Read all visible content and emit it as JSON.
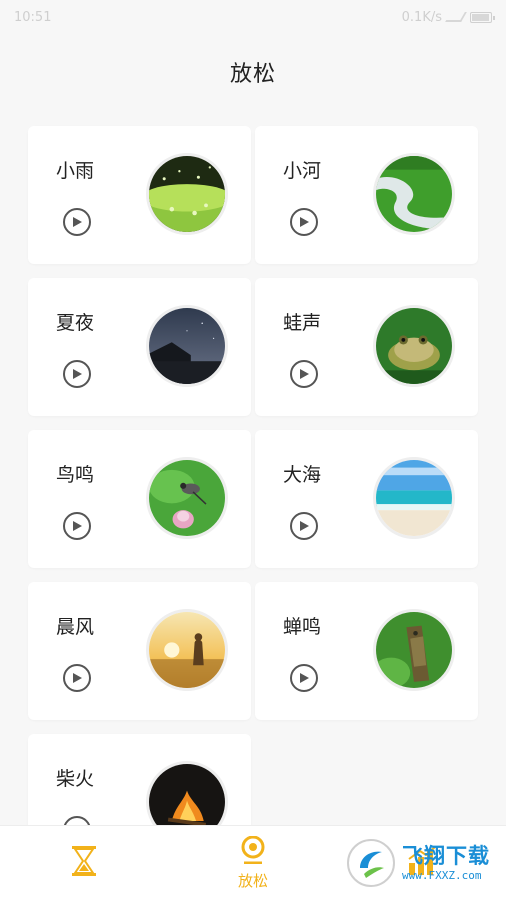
{
  "status_bar": {
    "time": "10:51",
    "right_text": "0.1K/s"
  },
  "header": {
    "title": "放松"
  },
  "sounds": [
    {
      "label": "小雨",
      "icon": "play-icon",
      "thumbnail": "rain-on-grass"
    },
    {
      "label": "小河",
      "icon": "play-icon",
      "thumbnail": "river"
    },
    {
      "label": "夏夜",
      "icon": "play-icon",
      "thumbnail": "night-sky"
    },
    {
      "label": "蛙声",
      "icon": "play-icon",
      "thumbnail": "frog"
    },
    {
      "label": "鸟鸣",
      "icon": "play-icon",
      "thumbnail": "bird-on-lotus"
    },
    {
      "label": "大海",
      "icon": "play-icon",
      "thumbnail": "sea"
    },
    {
      "label": "晨风",
      "icon": "play-icon",
      "thumbnail": "morning-sunrise"
    },
    {
      "label": "蝉鸣",
      "icon": "play-icon",
      "thumbnail": "cicada"
    },
    {
      "label": "柴火",
      "icon": "play-icon",
      "thumbnail": "campfire"
    }
  ],
  "tabbar": {
    "tabs": [
      {
        "label": "",
        "icon": "hourglass-icon"
      },
      {
        "label": "放松",
        "icon": "relax-icon",
        "active": true
      },
      {
        "label": "",
        "icon": "chart-icon"
      }
    ]
  },
  "watermark": {
    "title": "飞翔下载",
    "url": "www.FXXZ.com"
  },
  "colors": {
    "accent": "#f2b21a",
    "background": "#f7f7f7",
    "card": "#ffffff"
  }
}
